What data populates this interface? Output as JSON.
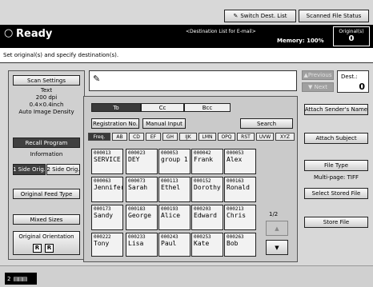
{
  "topbar": {
    "switch_dest": "Switch Dest. List",
    "scanned_status": "Scanned File Status"
  },
  "status": {
    "ready": "Ready",
    "dest_caption": "<Destination List for E-mail>",
    "memory": "Memory: 100%",
    "originals_label": "Original(s)",
    "originals_count": "0"
  },
  "message": "Set original(s) and specify destination(s).",
  "left": {
    "scan_settings": "Scan Settings",
    "settings_lines": [
      "Text",
      "200 dpi",
      "0.4×0.4inch",
      "Auto Image Density"
    ],
    "recall_program": "Recall Program",
    "information": "Information",
    "one_side": "1 Side Orig.",
    "two_side": "2 Side Orig.",
    "feed_type": "Original Feed Type",
    "mixed_sizes": "Mixed Sizes",
    "orientation": "Original Orientation"
  },
  "dest": {
    "previous": "▲Previous",
    "next": "▼ Next",
    "label": "Dest.:",
    "count": "0"
  },
  "tabs": {
    "to": "To",
    "cc": "Cc",
    "bcc": "Bcc"
  },
  "actions": {
    "reg_no": "Registration No.",
    "manual": "Manual Input",
    "search": "Search"
  },
  "letters": [
    "Freq.",
    "AB",
    "CD",
    "EF",
    "GH",
    "IJK",
    "LMN",
    "OPQ",
    "RST",
    "UVW",
    "XYZ"
  ],
  "entries": [
    {
      "id": "000013",
      "name": "SERVICE"
    },
    {
      "id": "000023",
      "name": "DEY"
    },
    {
      "id": "000053",
      "name": "group 1"
    },
    {
      "id": "000042",
      "name": "Frank"
    },
    {
      "id": "000053",
      "name": "Alex"
    },
    {
      "id": "000063",
      "name": "Jennifer"
    },
    {
      "id": "000073",
      "name": "Sarah"
    },
    {
      "id": "000113",
      "name": "Ethel"
    },
    {
      "id": "000152",
      "name": "Dorothy"
    },
    {
      "id": "000163",
      "name": "Ronald"
    },
    {
      "id": "000173",
      "name": "Sandy"
    },
    {
      "id": "000183",
      "name": "George"
    },
    {
      "id": "000193",
      "name": "Alice"
    },
    {
      "id": "000203",
      "name": "Edward"
    },
    {
      "id": "000213",
      "name": "Chris"
    },
    {
      "id": "000222",
      "name": "Tony"
    },
    {
      "id": "000233",
      "name": "Lisa"
    },
    {
      "id": "000243",
      "name": "Paul"
    },
    {
      "id": "000253",
      "name": "Kate"
    },
    {
      "id": "000263",
      "name": "Bob"
    }
  ],
  "page": "1/2",
  "right": {
    "attach_sender": "Attach Sender's Name",
    "attach_subject": "Attach Subject",
    "file_type": "File Type",
    "multipage": "Multi-page: TIFF",
    "select_stored": "Select Stored File",
    "store_file": "Store File"
  },
  "footer": {
    "job_number": "2"
  }
}
